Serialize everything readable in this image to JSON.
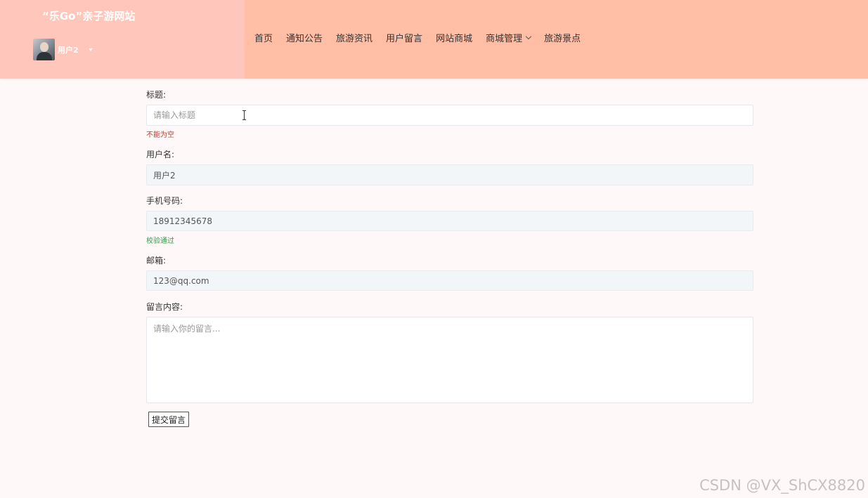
{
  "header": {
    "site_title": "“乐Go”亲子游网站",
    "user": {
      "name": "用户2",
      "avatar": "user-avatar-photo"
    },
    "nav": [
      {
        "label": "首页"
      },
      {
        "label": "通知公告"
      },
      {
        "label": "旅游资讯"
      },
      {
        "label": "用户留言"
      },
      {
        "label": "网站商城"
      },
      {
        "label": "商城管理",
        "has_dropdown": true
      },
      {
        "label": "旅游景点"
      }
    ],
    "colors": {
      "brand_bg": "#ffc6bb",
      "nav_bg": "#ffbea5"
    }
  },
  "form": {
    "title": {
      "label": "标题:",
      "placeholder": "请输入标题",
      "value": "",
      "hint": "不能为空"
    },
    "username": {
      "label": "用户名:",
      "value": "用户2"
    },
    "phone": {
      "label": "手机号码:",
      "value": "18912345678",
      "hint": "校验通过"
    },
    "email": {
      "label": "邮箱:",
      "value": "123@qq.com"
    },
    "content": {
      "label": "留言内容:",
      "placeholder": "请输入你的留言..."
    },
    "submit_label": "提交留言"
  },
  "watermark": "CSDN @VX_ShCX8820"
}
